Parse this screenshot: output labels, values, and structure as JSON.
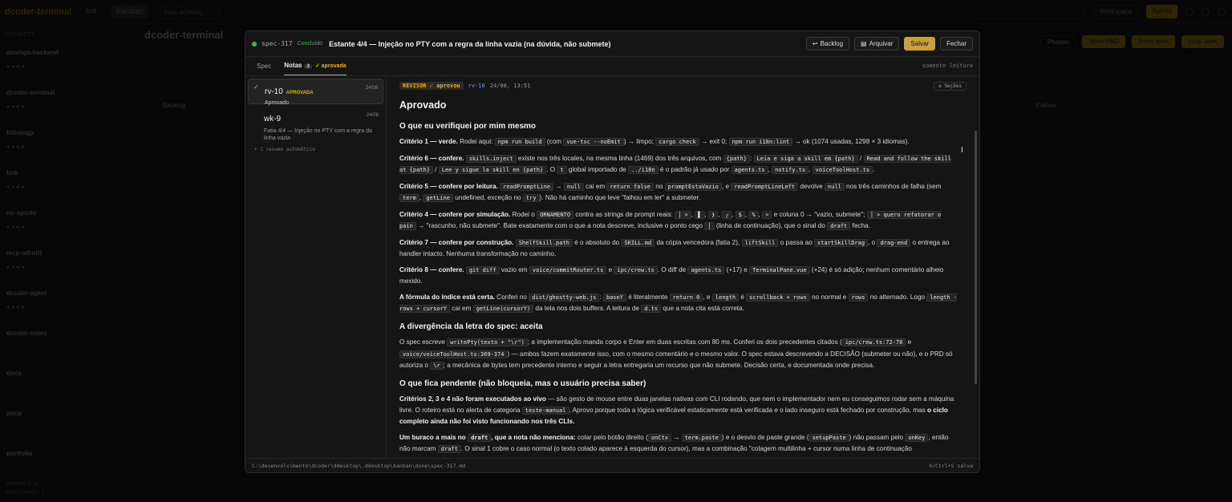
{
  "background": {
    "brand": "dcoder-terminal",
    "tabs": [
      "Init",
      "Kanban"
    ],
    "search_placeholder": "Find anything",
    "workspace_label": "Workspace",
    "agents_label": "Agents",
    "sidebar_header": "PROJECTS",
    "projects": [
      "ameliga-backend",
      "dcoder-terminal",
      "tribology",
      "bnb",
      "mr-sports",
      "mcp-adroitt",
      "dcoder-agent",
      "dcoder-notes",
      "docs",
      "pncp",
      "portfolio"
    ],
    "board_title": "dcoder-terminal",
    "board_buttons": [
      "Phases",
      "Novo PRD",
      "Novo spec",
      "Loop spec"
    ],
    "columns": [
      "Backlog",
      "Falhou"
    ],
    "sidebar_footer": [
      "Session: 3 ok",
      "Active review: 1"
    ]
  },
  "modal": {
    "spec_id": "spec-317",
    "status": "Concluído",
    "title": "Estante 4/4 — Injeção no PTY com a regra da linha vazia (na dúvida, não submete)",
    "buttons": {
      "backlog": "Backlog",
      "archive": "Arquivar",
      "save": "Salvar",
      "close": "Fechar"
    },
    "tabs": {
      "spec": "Spec",
      "notes": "Notas",
      "notes_count": "3",
      "approved": "✓ aprovada"
    },
    "readonly": "somente leitura",
    "notes": [
      {
        "id": "rv-10",
        "badge": "APROVADA",
        "date": "24/08",
        "summary": "Aprovado"
      },
      {
        "id": "wk-9",
        "date": "24/08",
        "summary": "Fatia 4/4 — Injeção no PTY com a regra da linha vazia"
      }
    ],
    "auto_summary": "+ 1 resumo automático",
    "content_header": {
      "reviewer": "REVISOR ✓ aprovou",
      "note_id": "rv-10",
      "date": "24/08, 13:51",
      "sections": "≡ Seções"
    },
    "footer_path": "C:\\desenvolvimento\\dcoder\\ddesktop\\.ddesktop\\kanban\\done\\spec-317.md",
    "footer_hint": "⌘/Ctrl+S salva"
  }
}
